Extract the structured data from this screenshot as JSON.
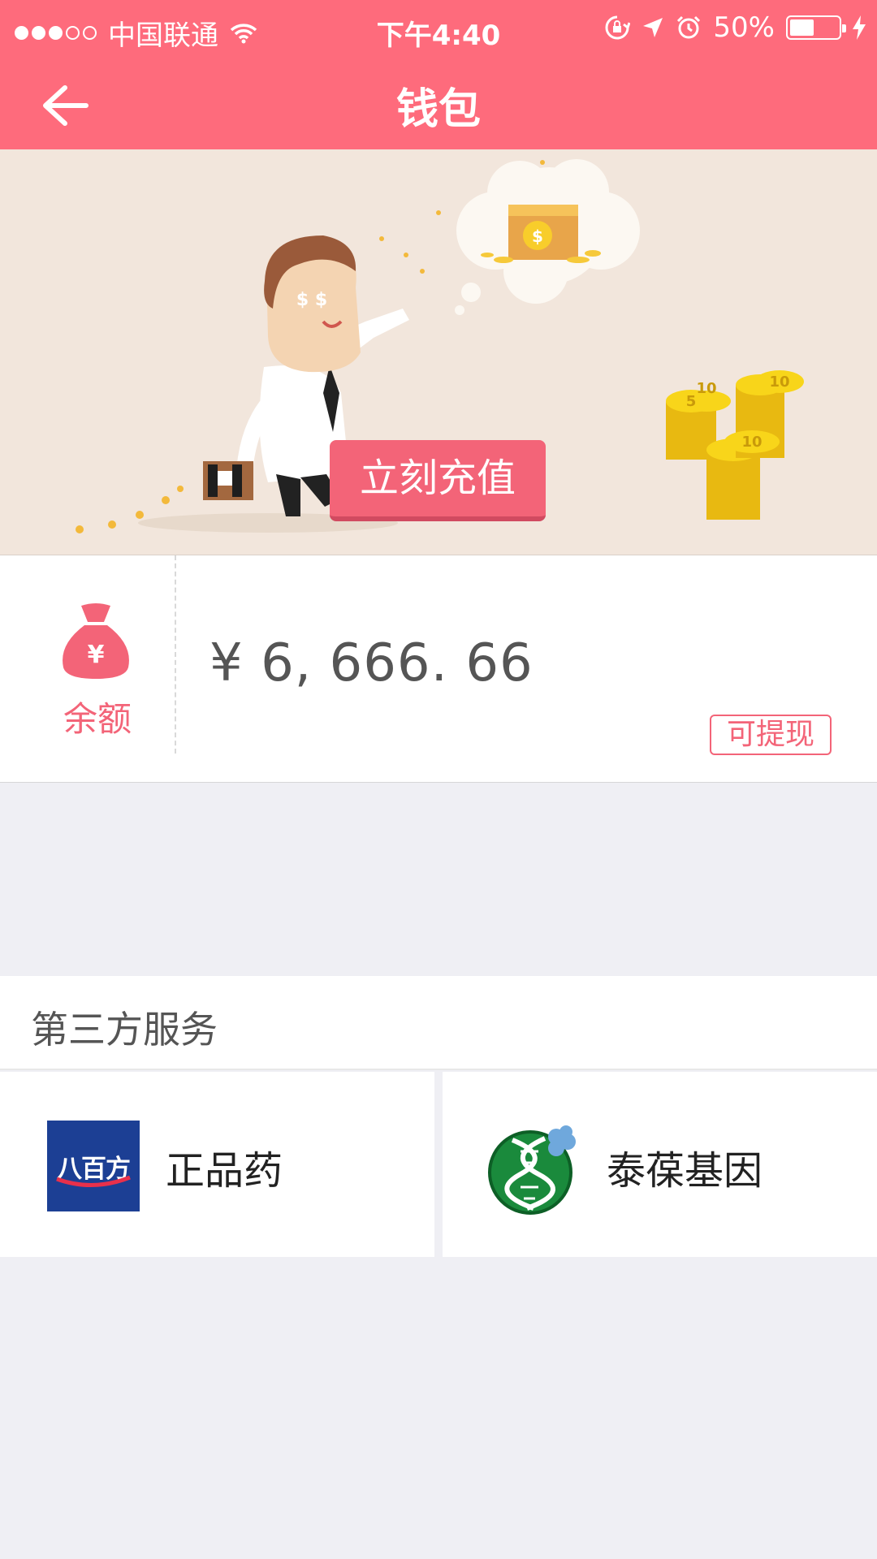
{
  "status_bar": {
    "signal_dots": [
      true,
      true,
      true,
      false,
      false
    ],
    "carrier": "中国联通",
    "time": "下午4:40",
    "battery_percent": "50%",
    "battery_level": 0.5,
    "icons": [
      "wifi-icon",
      "orientation-lock-icon",
      "location-arrow-icon",
      "alarm-icon",
      "battery-icon",
      "charging-bolt-icon"
    ]
  },
  "nav": {
    "title": "钱包",
    "back_icon": "back-arrow-icon"
  },
  "banner": {
    "recharge_label": "立刻充值"
  },
  "balance": {
    "icon": "money-bag-icon",
    "label": "余额",
    "amount": "¥ 6, 666. 66",
    "withdraw_label": "可提现"
  },
  "third_party": {
    "title": "第三方服务",
    "services": [
      {
        "logo_icon": "babaifang-logo",
        "logo_text": "八百方",
        "label": "正品药"
      },
      {
        "logo_icon": "dna-logo",
        "label": "泰葆基因"
      }
    ]
  },
  "colors": {
    "accent": "#fe6b7c",
    "button": "#f36478",
    "banner_bg": "#f2e6dc",
    "page_bg": "#efeff4"
  }
}
